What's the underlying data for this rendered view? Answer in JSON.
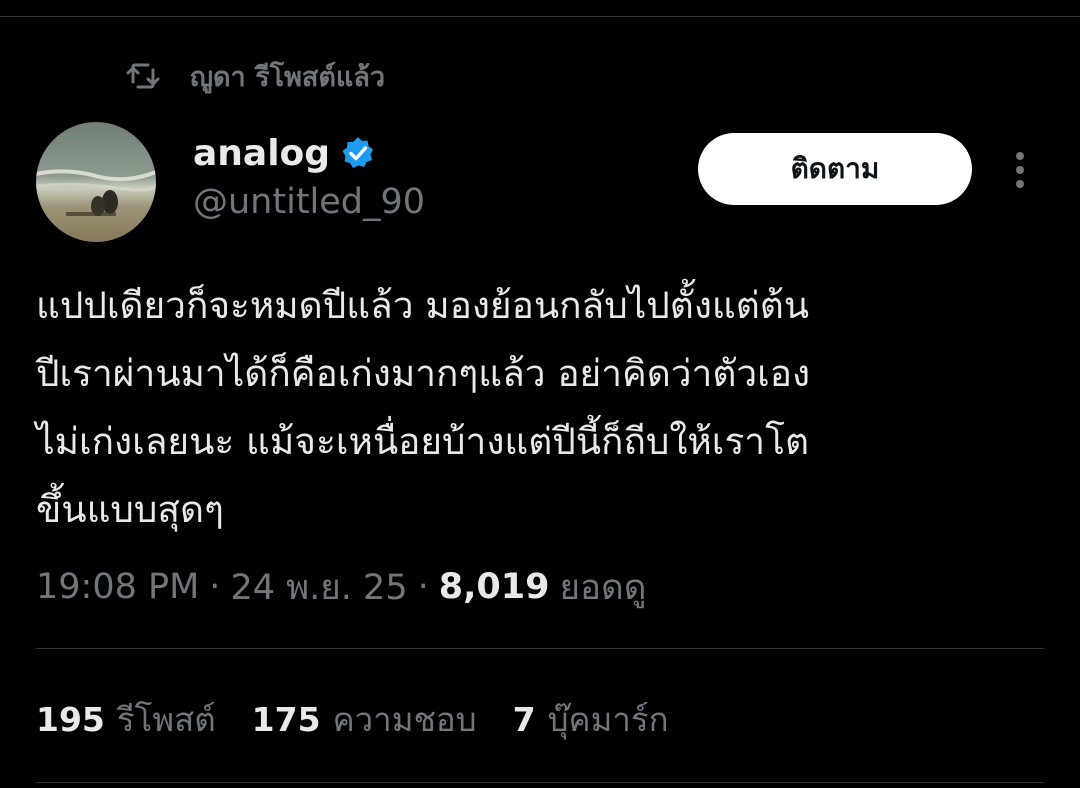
{
  "repost": {
    "icon": "repost-icon",
    "label": "ญูดา รีโพสต์แล้ว"
  },
  "author": {
    "display_name": "analog",
    "handle": "@untitled_90",
    "verified": true,
    "verified_icon": "verified-badge-icon",
    "avatar": "beach-photo-avatar"
  },
  "actions": {
    "follow_label": "ติดตาม",
    "more_icon": "more-vertical-icon"
  },
  "tweet": {
    "text": "แปปเดียวก็จะหมดปีแล้ว มองย้อนกลับไปตั้งแต่ต้น\nปีเราผ่านมาได้ก็คือเก่งมากๆแล้ว อย่าคิดว่าตัวเอง\nไม่เก่งเลยนะ แม้จะเหนื่อยบ้างแต่ปีนี้ก็ถีบให้เราโต\nขึ้นแบบสุดๆ"
  },
  "meta": {
    "time": "19:08 PM",
    "separator": "·",
    "date": "24 พ.ย. 25",
    "views_count": "8,019",
    "views_label": "ยอดดู"
  },
  "stats": {
    "reposts": {
      "count": "195",
      "label": "รีโพสต์"
    },
    "likes": {
      "count": "175",
      "label": "ความชอบ"
    },
    "bookmarks": {
      "count": "7",
      "label": "บุ๊คมาร์ก"
    }
  },
  "colors": {
    "background": "#000000",
    "primary_text": "#e7e9ea",
    "secondary_text": "#71767b",
    "divider": "#2f3336",
    "verified_blue": "#1d9bf0",
    "follow_button_bg": "#ffffff"
  }
}
